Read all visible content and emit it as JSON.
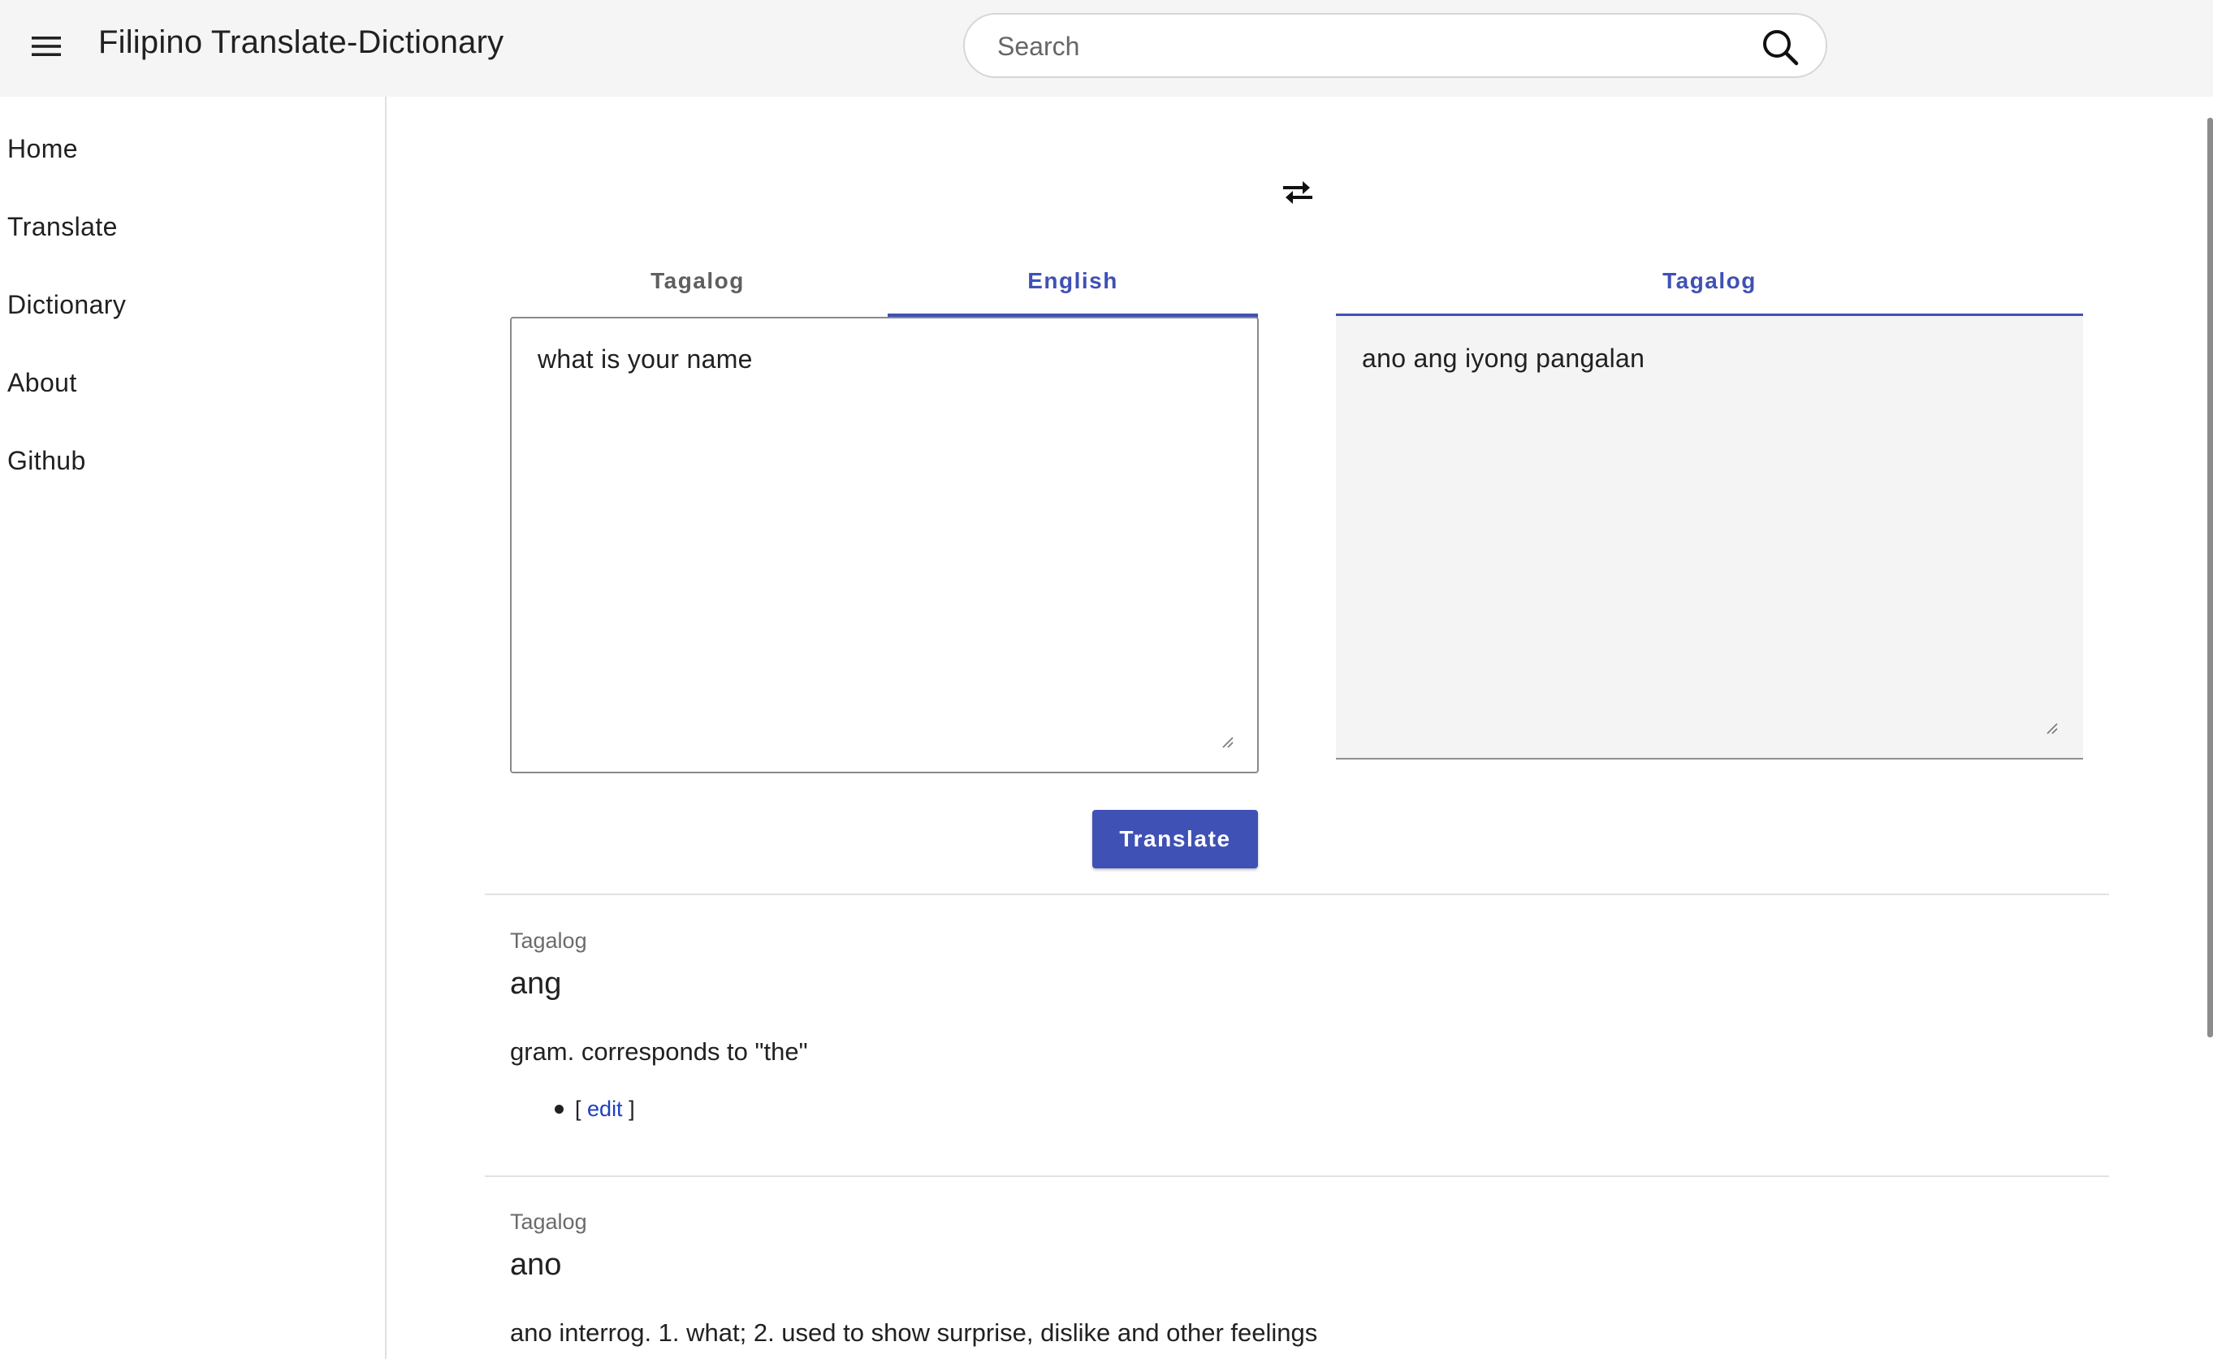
{
  "header": {
    "title": "Filipino Translate-Dictionary",
    "search_placeholder": "Search"
  },
  "sidebar": {
    "items": [
      {
        "label": "Home"
      },
      {
        "label": "Translate"
      },
      {
        "label": "Dictionary"
      },
      {
        "label": "About"
      },
      {
        "label": "Github"
      }
    ]
  },
  "translator": {
    "source_tabs": [
      {
        "label": "Tagalog",
        "active": false
      },
      {
        "label": "English",
        "active": true
      }
    ],
    "target_tab": {
      "label": "Tagalog",
      "active": true
    },
    "source_text": "what is your name",
    "target_text": "ano ang iyong pangalan",
    "translate_label": "Translate"
  },
  "entries": [
    {
      "language": "Tagalog",
      "word": "ang",
      "definition": "gram. corresponds to \"the\"",
      "edit_open": "[",
      "edit_label": "edit",
      "edit_close": "]"
    },
    {
      "language": "Tagalog",
      "word": "ano",
      "definition": "ano interrog. 1. what; 2. used to show surprise, dislike and other feelings"
    }
  ],
  "icons": {
    "menu": "hamburger-menu-icon",
    "search": "search-icon",
    "swap": "swap-arrows-icon"
  },
  "colors": {
    "accent": "#3f51b5",
    "appbar_bg": "#f5f5f5",
    "link": "#1f3fbf"
  }
}
